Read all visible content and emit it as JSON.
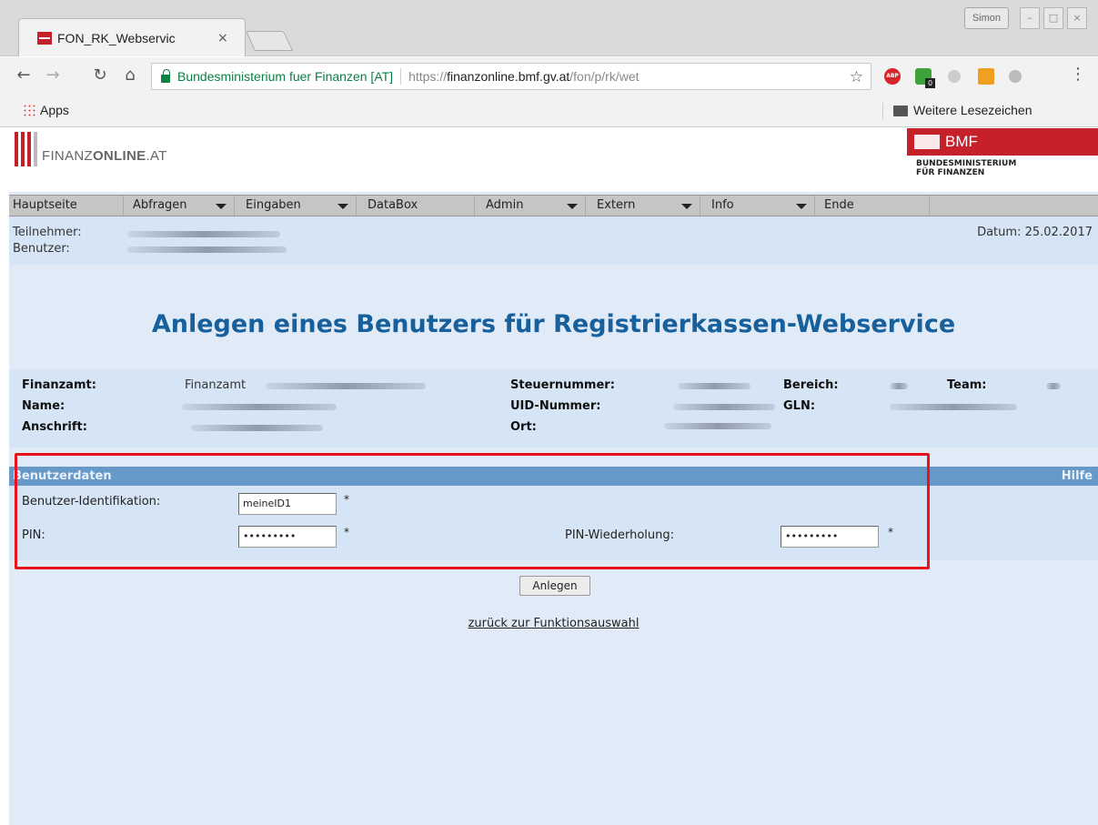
{
  "browser": {
    "tab_title": "FON_RK_Webservic",
    "tab_close": "×",
    "user_badge": "Simon",
    "security_label": "Bundesministerium fuer Finanzen [AT]",
    "url_scheme": "https://",
    "url_host": "finanzonline.bmf.gv.at",
    "url_path": "/fon/p/rk/wet",
    "extension_badge_count": "0",
    "extension_abp_label": "ABP",
    "bookmarks": {
      "apps_label": "Apps",
      "other_label": "Weitere Lesezeichen"
    }
  },
  "header": {
    "logo_text_prefix": "FINANZ",
    "logo_text_bold": "ONLINE",
    "logo_text_suffix": ".AT",
    "bmf_label": "BMF",
    "bmf_sub_line1": "BUNDESMINISTERIUM",
    "bmf_sub_line2": "FÜR FINANZEN"
  },
  "menu": {
    "items": [
      {
        "label": "Hauptseite",
        "dropdown": false
      },
      {
        "label": "Abfragen",
        "dropdown": true
      },
      {
        "label": "Eingaben",
        "dropdown": true
      },
      {
        "label": "DataBox",
        "dropdown": false
      },
      {
        "label": "Admin",
        "dropdown": true
      },
      {
        "label": "Extern",
        "dropdown": true
      },
      {
        "label": "Info",
        "dropdown": true
      },
      {
        "label": "Ende",
        "dropdown": false
      }
    ]
  },
  "userbar": {
    "teilnehmer_label": "Teilnehmer:",
    "benutzer_label": "Benutzer:",
    "datum_label": "Datum:",
    "datum_value": "25.02.2017"
  },
  "page": {
    "title": "Anlegen eines Benutzers für Registrierkassen-Webservice"
  },
  "info": {
    "finanzamt_label": "Finanzamt:",
    "finanzamt_value": "Finanzamt",
    "name_label": "Name:",
    "anschrift_label": "Anschrift:",
    "steuernummer_label": "Steuernummer:",
    "uid_label": "UID-Nummer:",
    "ort_label": "Ort:",
    "bereich_label": "Bereich:",
    "gln_label": "GLN:",
    "team_label": "Team:"
  },
  "form": {
    "section_title": "Benutzerdaten",
    "help_link": "Hilfe",
    "benutzer_id_label": "Benutzer-Identifikation:",
    "benutzer_id_value": "meineID1",
    "pin_label": "PIN:",
    "pin_value": "•••••••••",
    "pin_repeat_label": "PIN-Wiederholung:",
    "pin_repeat_value": "•••••••••",
    "required_marker": "*",
    "submit_label": "Anlegen",
    "back_link": "zurück zur Funktionsauswahl"
  },
  "colors": {
    "brand_red": "#c6202a",
    "title_blue": "#17609c",
    "section_blue": "#6698c8",
    "highlight_red": "#e8121c"
  }
}
